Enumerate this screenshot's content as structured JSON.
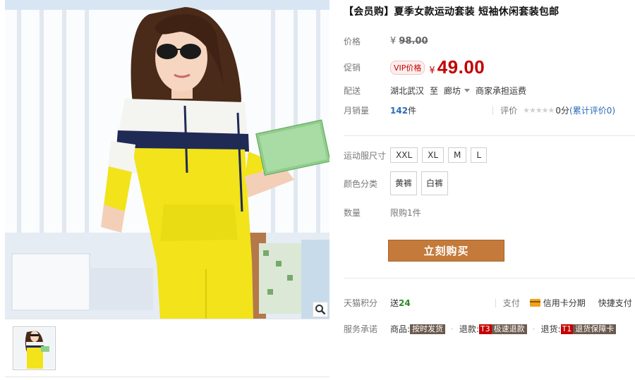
{
  "product": {
    "title": "【会员购】夏季女款运动套装 短袖休闲套装包邮"
  },
  "price": {
    "label": "价格",
    "currency": "¥",
    "original": "98.00"
  },
  "promo": {
    "label": "促销",
    "badge": "VIP价格",
    "currency": "¥",
    "price": "49.00"
  },
  "shipping": {
    "label": "配送",
    "from": "湖北武汉",
    "to_word": "至",
    "to": "廊坊",
    "fee": "商家承担运费"
  },
  "sales": {
    "label": "月销量",
    "count": "142",
    "unit": "件",
    "review_label": "评价",
    "stars": "★★★★★",
    "score": "0分",
    "review_link": "(累计评价0)"
  },
  "sku": {
    "size_label": "运动服尺寸",
    "sizes": [
      "XXL",
      "XL",
      "M",
      "L"
    ],
    "color_label": "颜色分类",
    "colors": [
      "黄裤",
      "白裤"
    ],
    "qty_label": "数量",
    "qty_limit": "限购1件"
  },
  "actions": {
    "buy_now": "立刻购买"
  },
  "extras": {
    "points_label": "天猫积分",
    "points_prefix": "送",
    "points_value": "24",
    "pay_label": "支付",
    "pay_credit": "信用卡分期",
    "pay_quick": "快捷支付",
    "service_label": "服务承诺",
    "goods_label": "商品:",
    "goods_tag": "按时发货",
    "refund_label": "退款:",
    "refund_t": "T3",
    "refund_tag": "极速退款",
    "return_label": "退货:",
    "return_t": "T1",
    "return_tag": "退货保障卡"
  },
  "colors": {
    "accent_red": "#c40000",
    "buy_button": "#c47a3a",
    "link_blue": "#2a6ab8",
    "shirt_yellow": "#f2e31a",
    "stripe_navy": "#1f2a55"
  },
  "icons": {
    "zoom": "magnifier-icon",
    "caret": "caret-down-icon",
    "card": "credit-card-icon"
  }
}
